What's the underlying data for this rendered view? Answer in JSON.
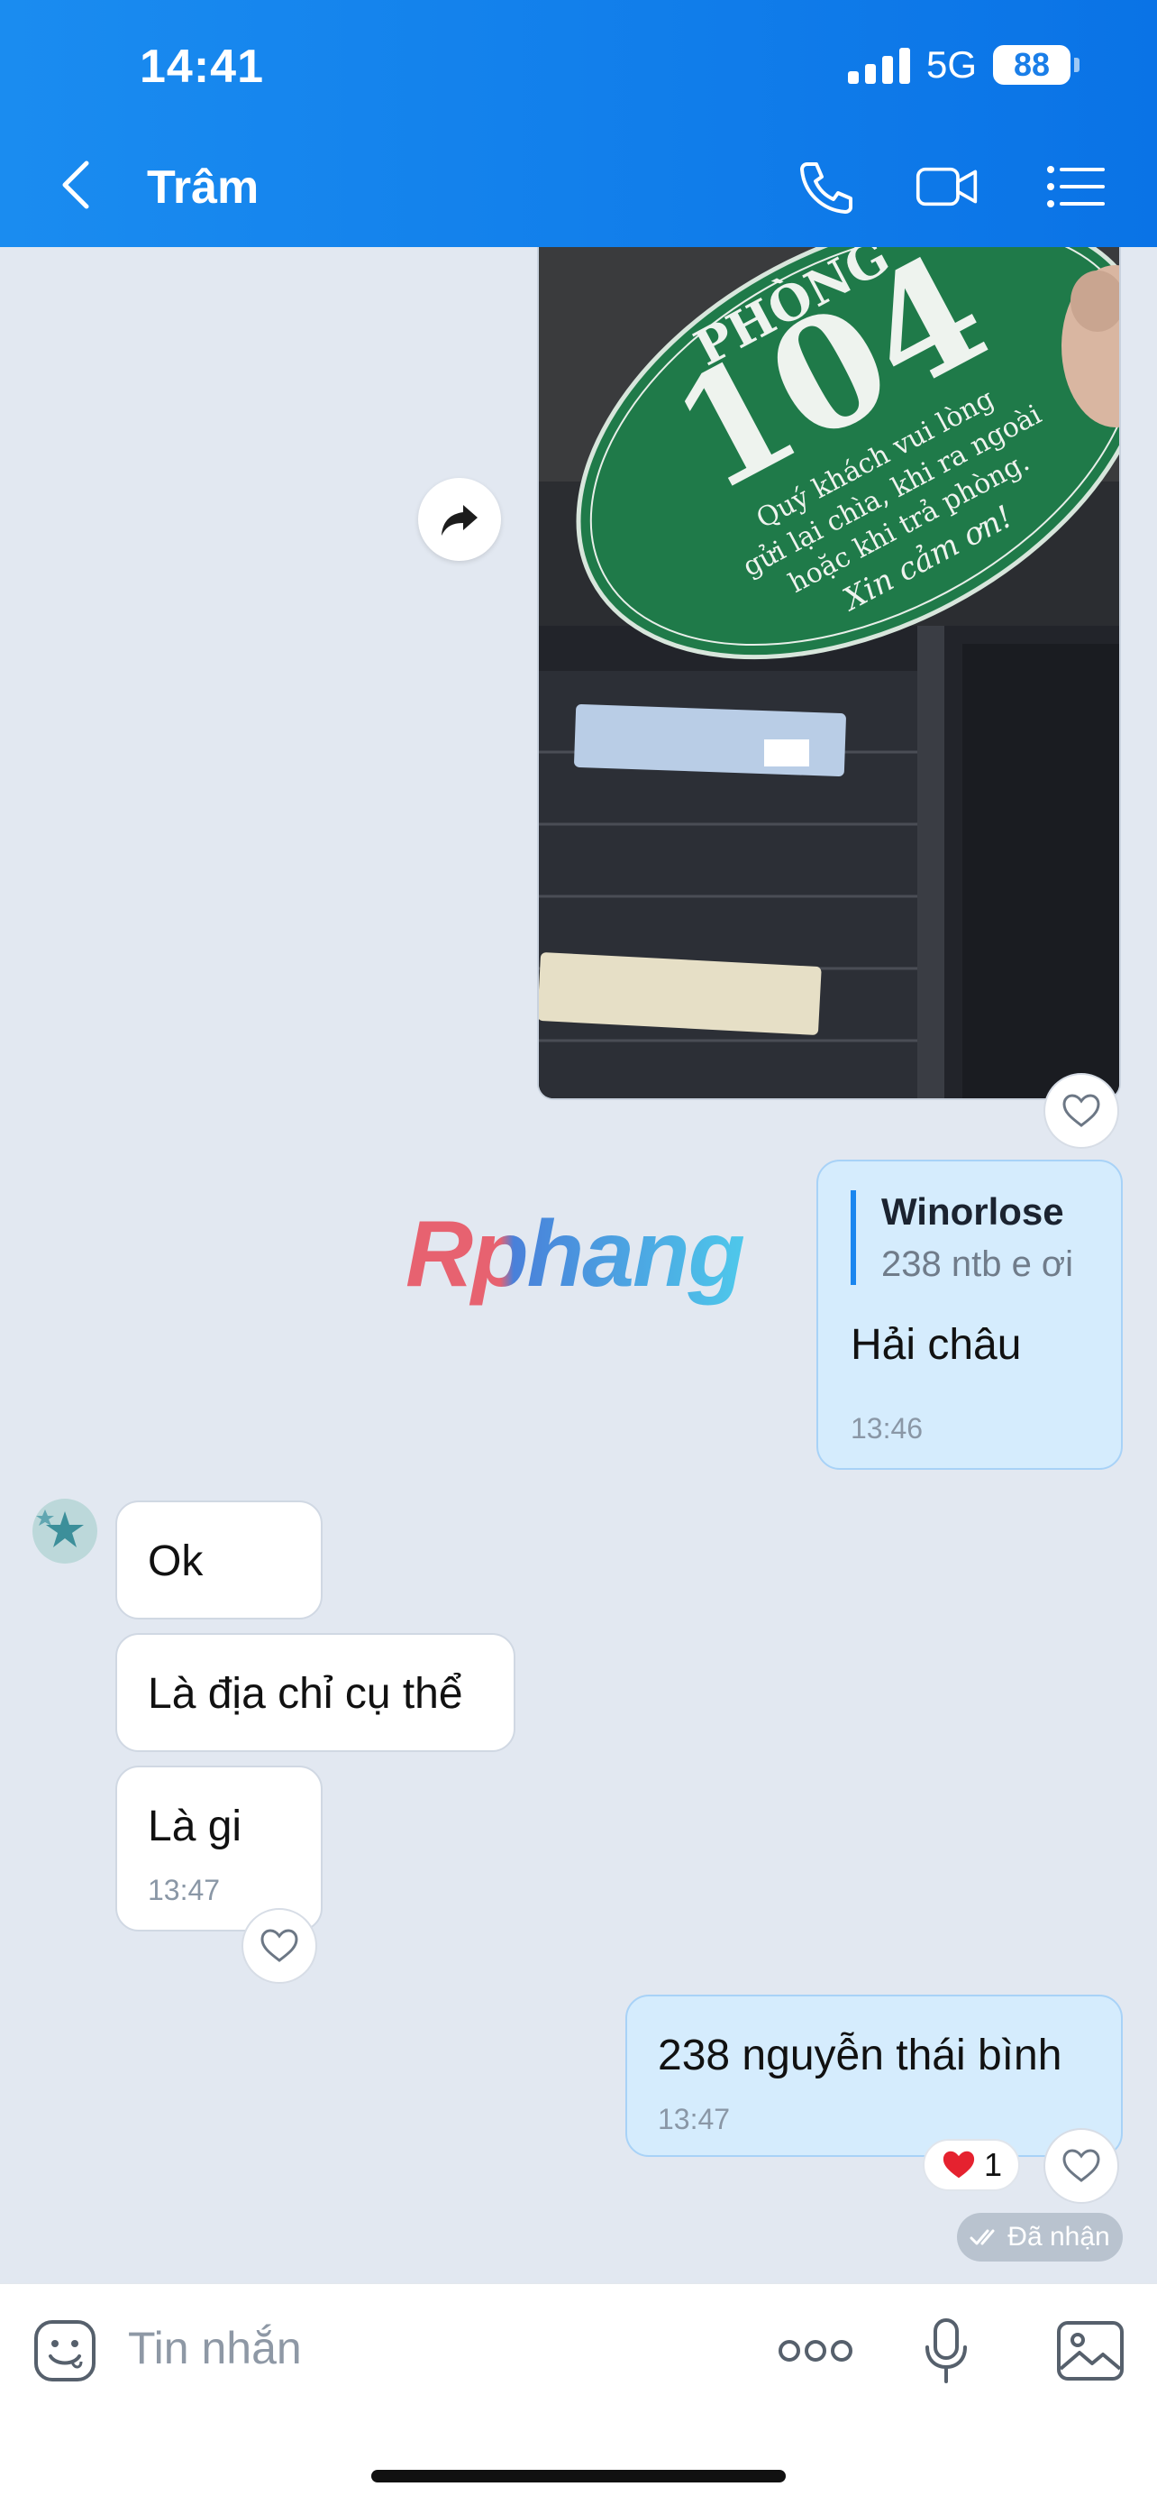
{
  "status_bar": {
    "time": "14:41",
    "network": "5G",
    "battery": "88"
  },
  "header": {
    "contact_name": "Trâm"
  },
  "watermark": "Rphang",
  "photo": {
    "tag_title": "PHÒNG",
    "room_number": "104",
    "tag_lines": [
      "Quý khách vui lòng",
      "gửi lại chìa, khi ra ngoài",
      "hoặc khi trả phòng.",
      "Xin cảm ơn!"
    ]
  },
  "messages": {
    "reply": {
      "quote_name": "Winorlose",
      "quote_text": "238 ntb e ơi",
      "text": "Hải châu",
      "time": "13:46"
    },
    "ok": {
      "text": "Ok"
    },
    "address_q": {
      "text": "Là địa chỉ cụ thể"
    },
    "what": {
      "text": "Là gi",
      "time": "13:47"
    },
    "address": {
      "text": "238 nguyễn thái bình",
      "time": "13:47"
    }
  },
  "reaction": {
    "icon": "heart",
    "count": "1"
  },
  "received_label": "Đã nhận",
  "composer": {
    "placeholder": "Tin nhắn"
  }
}
